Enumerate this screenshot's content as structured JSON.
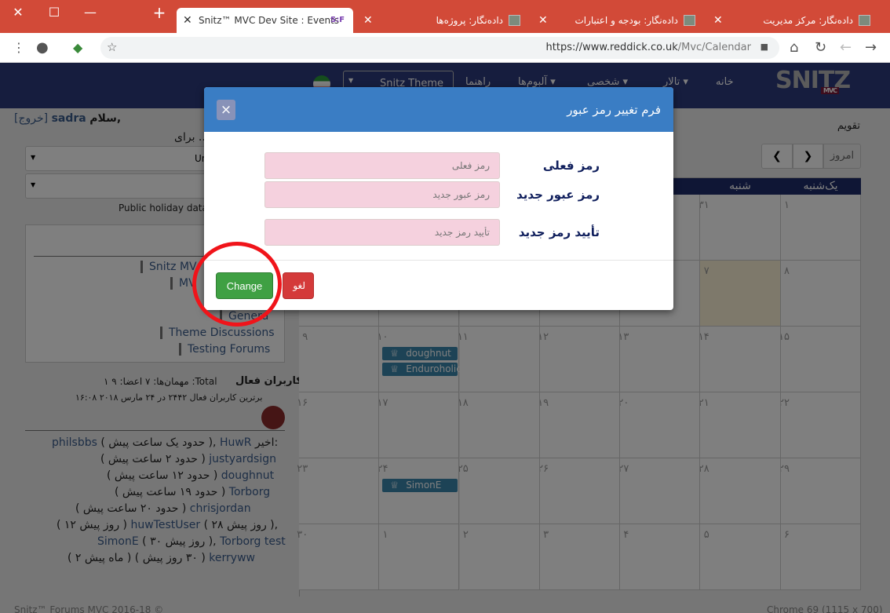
{
  "browser": {
    "tabs": [
      {
        "title": "Snitz™ MVC Dev Site : Events",
        "favicon_text": "S:F"
      },
      {
        "title": "داده‌نگار: پروژه‌ها"
      },
      {
        "title": "داده‌نگار: بودجه و اعتبارات"
      },
      {
        "title": "داده‌نگار: مرکز مدیریت"
      }
    ],
    "url_host": "https://www.reddick.co.uk",
    "url_path": "/Mvc/Calendar",
    "window_controls": {
      "close": "✕",
      "maximize": "☐",
      "minimize": "—"
    },
    "new_tab": "+"
  },
  "site": {
    "logo": "SNITZ",
    "logo_sub": "MVC",
    "nav": [
      "خانه",
      "تالار ▾",
      "شخصی ▾",
      "آلبوم‌ها ▾",
      "راهنما"
    ],
    "theme_select": "Snitz Theme",
    "greeting": "سلام,",
    "username": "sadra",
    "logout": "[خروج]",
    "page_label": "تقویم",
    "for_text": "برای ..",
    "select1_value": "Un",
    "public_holiday": "Public holiday data",
    "forum_links": [
      "Snitz MV",
      "MV",
      "Genera",
      "Theme Discussions",
      "Testing Forums"
    ],
    "active_users_line": "کاربران فعال",
    "active_users_counts": "مهمان‌ها: ۷ اعضا: ۹ ۱ :Total",
    "best_active": "برترین کاربران فعال ۲۴۴۲ در ۲۴ مارس ۲۰۱۸ ۱۶:۰۸",
    "latest_label": "اخیر:",
    "recent": [
      {
        "name": "HuwR",
        "time": "( حدود یک ساعت پیش ),",
        "name2": "philsbbs"
      },
      {
        "name": "justyardsign",
        "time": "( حدود ۲ ساعت پیش )"
      },
      {
        "name": "doughnut",
        "time": "( حدود ۱۲ ساعت پیش )"
      },
      {
        "name": "Torborg",
        "time": "( حدود ۱۹ ساعت پیش )"
      },
      {
        "name": "chrisjordan",
        "time": "( حدود ۲۰ ساعت پیش )"
      },
      {
        "name": "huwTestUser",
        "time": "( ۲۸ روز پیش ),",
        "time2": "( ۱۲ روز پیش )"
      },
      {
        "name": "Torborg test",
        "time": "( ۳۰ روز پیش ),",
        "name2": "SimonE"
      },
      {
        "name": "kerryww",
        "time": "( ۳۰ روز پیش )",
        "time2": "( ۲ ماه پیش )"
      }
    ],
    "footer_left": "Snitz™ Forums MVC 2016-18 ©",
    "footer_right": "Chrome 69 (1115 x 700)"
  },
  "calendar": {
    "today_btn": "امروز",
    "prev": "❯",
    "next": "❮",
    "day_headers": [
      "یک‌شنبه",
      "شنبه"
    ],
    "weeks": [
      [
        "۱",
        "۳۱",
        "",
        "",
        "",
        "",
        ""
      ],
      [
        "۸",
        "۷",
        "",
        "",
        "",
        "",
        ""
      ],
      [
        "۱۵",
        "۱۴",
        "۱۳",
        "۱۲",
        "۱۱",
        "۱۰",
        "۹"
      ],
      [
        "۲۲",
        "۲۱",
        "۲۰",
        "۱۹",
        "۱۸",
        "۱۷",
        "۱۶"
      ],
      [
        "۲۹",
        "۲۸",
        "۲۷",
        "۲۶",
        "۲۵",
        "۲۴",
        "۲۳"
      ],
      [
        "۶",
        "۵",
        "۴",
        "۳",
        "۲",
        "۱",
        "۳۰"
      ]
    ],
    "events": [
      "doughnut",
      "Enduroholic",
      "SimonE"
    ]
  },
  "modal": {
    "title": "فرم تغییر رمز عبور",
    "close": "×",
    "fields": [
      {
        "label": "رمز فعلی",
        "placeholder": "رمز فعلی"
      },
      {
        "label": "رمز عبور جدید",
        "placeholder": "رمز عبور جدید"
      },
      {
        "label": "تأیید رمز جدید",
        "placeholder": "تأیید رمز جدید"
      }
    ],
    "change_btn": "Change",
    "cancel_btn": "لغو"
  },
  "colors": {
    "titlebar": "#d24a38",
    "navbar": "#2d3a7c",
    "modal_header": "#3a7dc4",
    "input_bg": "#f5d1de",
    "highlight_circle": "#f0141a"
  }
}
